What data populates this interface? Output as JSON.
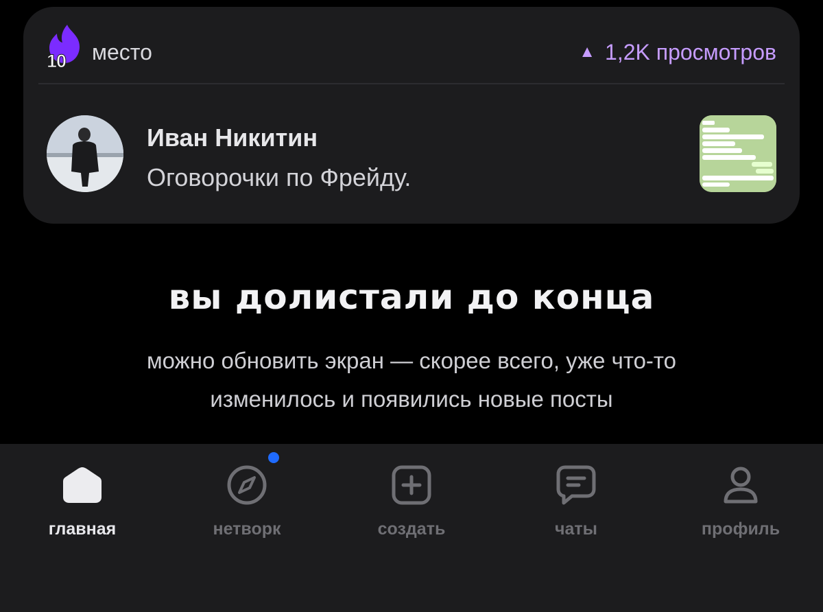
{
  "card": {
    "rank": "10",
    "place_label": "место",
    "views_arrow": "▲",
    "views": "1,2K просмотров",
    "author": "Иван Никитин",
    "post_title": "Оговорочки по Фрейду.",
    "accent_color": "#c69cff",
    "flame_color": "#7b2cff"
  },
  "end": {
    "title": "вы долистали до конца",
    "subtitle": "можно обновить экран — скорее всего, уже что-то изменилось и появились новые посты"
  },
  "tabbar": {
    "tabs": [
      {
        "label": "главная",
        "icon": "home-icon",
        "active": true
      },
      {
        "label": "нетворк",
        "icon": "compass-icon",
        "active": false,
        "badge": true
      },
      {
        "label": "создать",
        "icon": "plus-square-icon",
        "active": false
      },
      {
        "label": "чаты",
        "icon": "chat-icon",
        "active": false
      },
      {
        "label": "профиль",
        "icon": "profile-icon",
        "active": false
      }
    ],
    "badge_color": "#1f6bff"
  }
}
